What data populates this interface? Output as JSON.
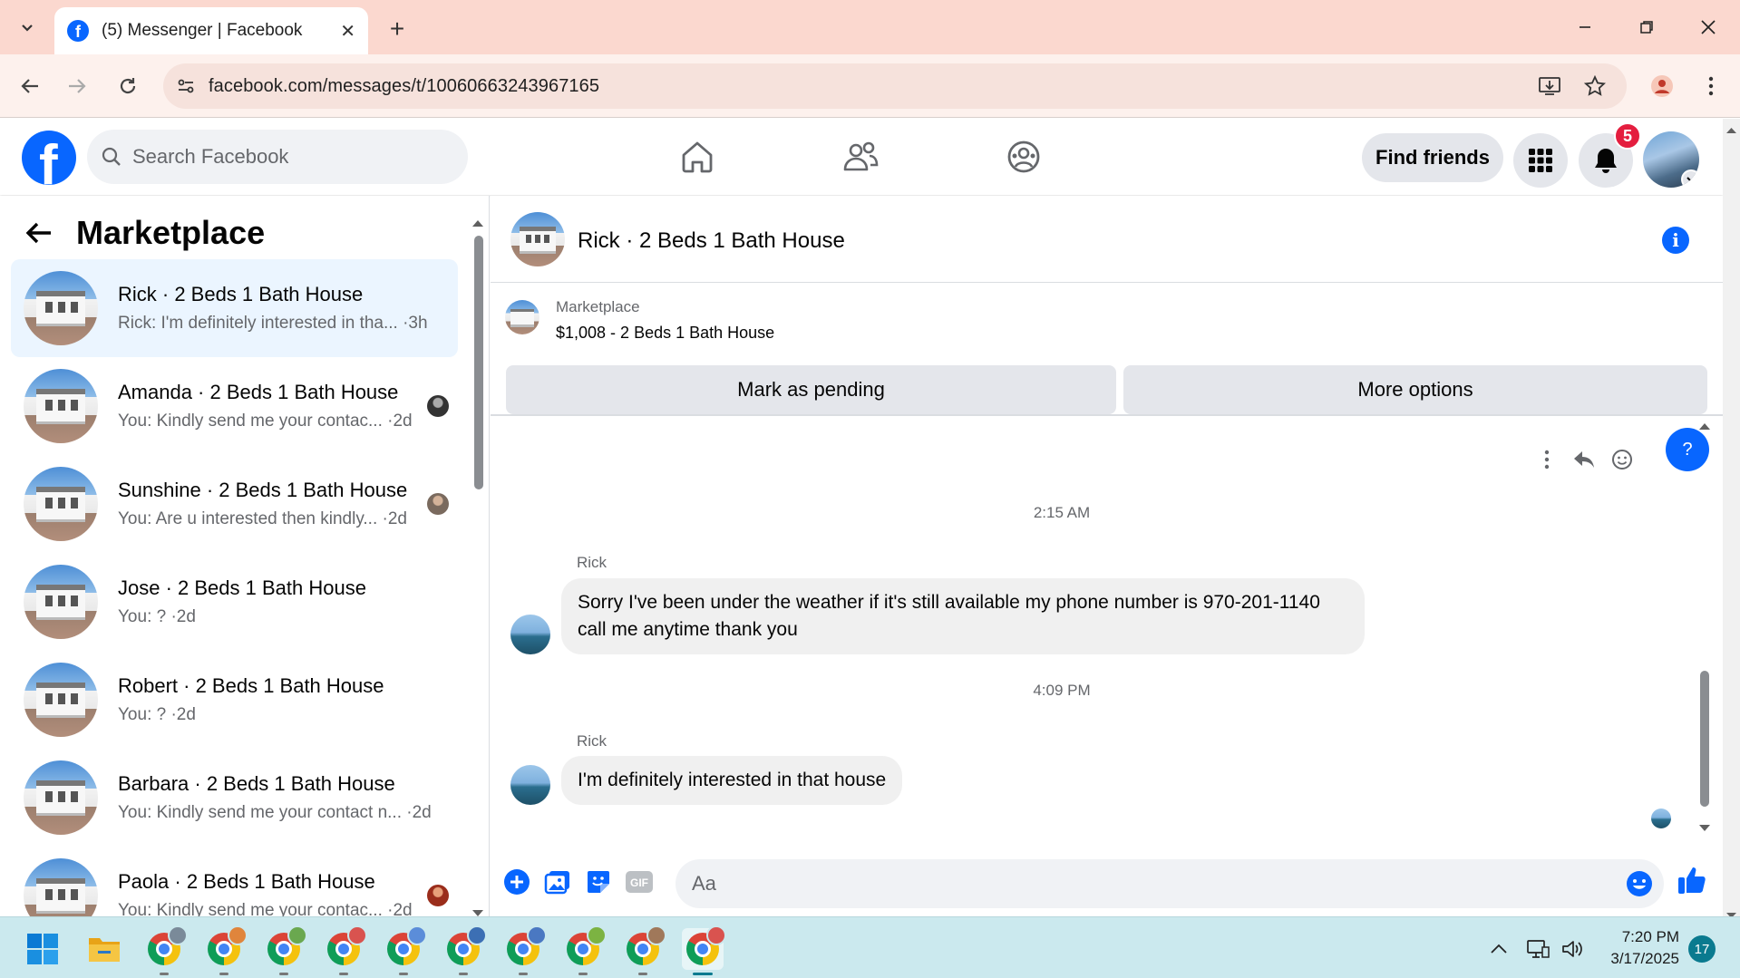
{
  "browser": {
    "tab_title": "(5) Messenger | Facebook",
    "url": "facebook.com/messages/t/10060663243967165"
  },
  "fb_header": {
    "search_placeholder": "Search Facebook",
    "find_friends_label": "Find friends",
    "notification_count": "5"
  },
  "sidebar": {
    "title": "Marketplace",
    "conversations": [
      {
        "name": "Rick · 2 Beds 1 Bath House",
        "preview": "Rick: I'm definitely interested in tha... ·3h",
        "active": true
      },
      {
        "name": "Amanda · 2 Beds 1 Bath House",
        "preview": "You: Kindly send me your contac... ·2d"
      },
      {
        "name": "Sunshine · 2 Beds 1 Bath House",
        "preview": "You: Are u interested then kindly... ·2d"
      },
      {
        "name": "Jose · 2 Beds 1 Bath House",
        "preview": "You: ? ·2d"
      },
      {
        "name": "Robert · 2 Beds 1 Bath House",
        "preview": "You: ? ·2d"
      },
      {
        "name": "Barbara · 2 Beds 1 Bath House",
        "preview": "You: Kindly send me your contact n... ·2d"
      },
      {
        "name": "Paola · 2 Beds 1 Bath House",
        "preview": "You: Kindly send me your contac... ·2d"
      }
    ]
  },
  "chat": {
    "title": "Rick · 2 Beds 1 Bath House",
    "marketplace_label": "Marketplace",
    "listing": "$1,008 - 2 Beds 1 Bath House",
    "mark_pending_label": "Mark as pending",
    "more_options_label": "More options",
    "help_label": "?",
    "messages": [
      {
        "time": "2:15 AM",
        "sender": "Rick",
        "text": "Sorry I've been under the weather if it's still available my phone number is 970-201-1140 call me anytime thank you"
      },
      {
        "time": "4:09 PM",
        "sender": "Rick",
        "text": "I'm definitely interested in that house"
      }
    ],
    "composer_placeholder": "Aa"
  },
  "taskbar": {
    "time": "7:20 PM",
    "date": "3/17/2025",
    "notification_count": "17"
  },
  "colors": {
    "facebook_blue": "#0866ff",
    "active_conversation": "#ebf5ff",
    "tab_strip": "#fbd8cf",
    "taskbar": "#cbe9ee"
  }
}
